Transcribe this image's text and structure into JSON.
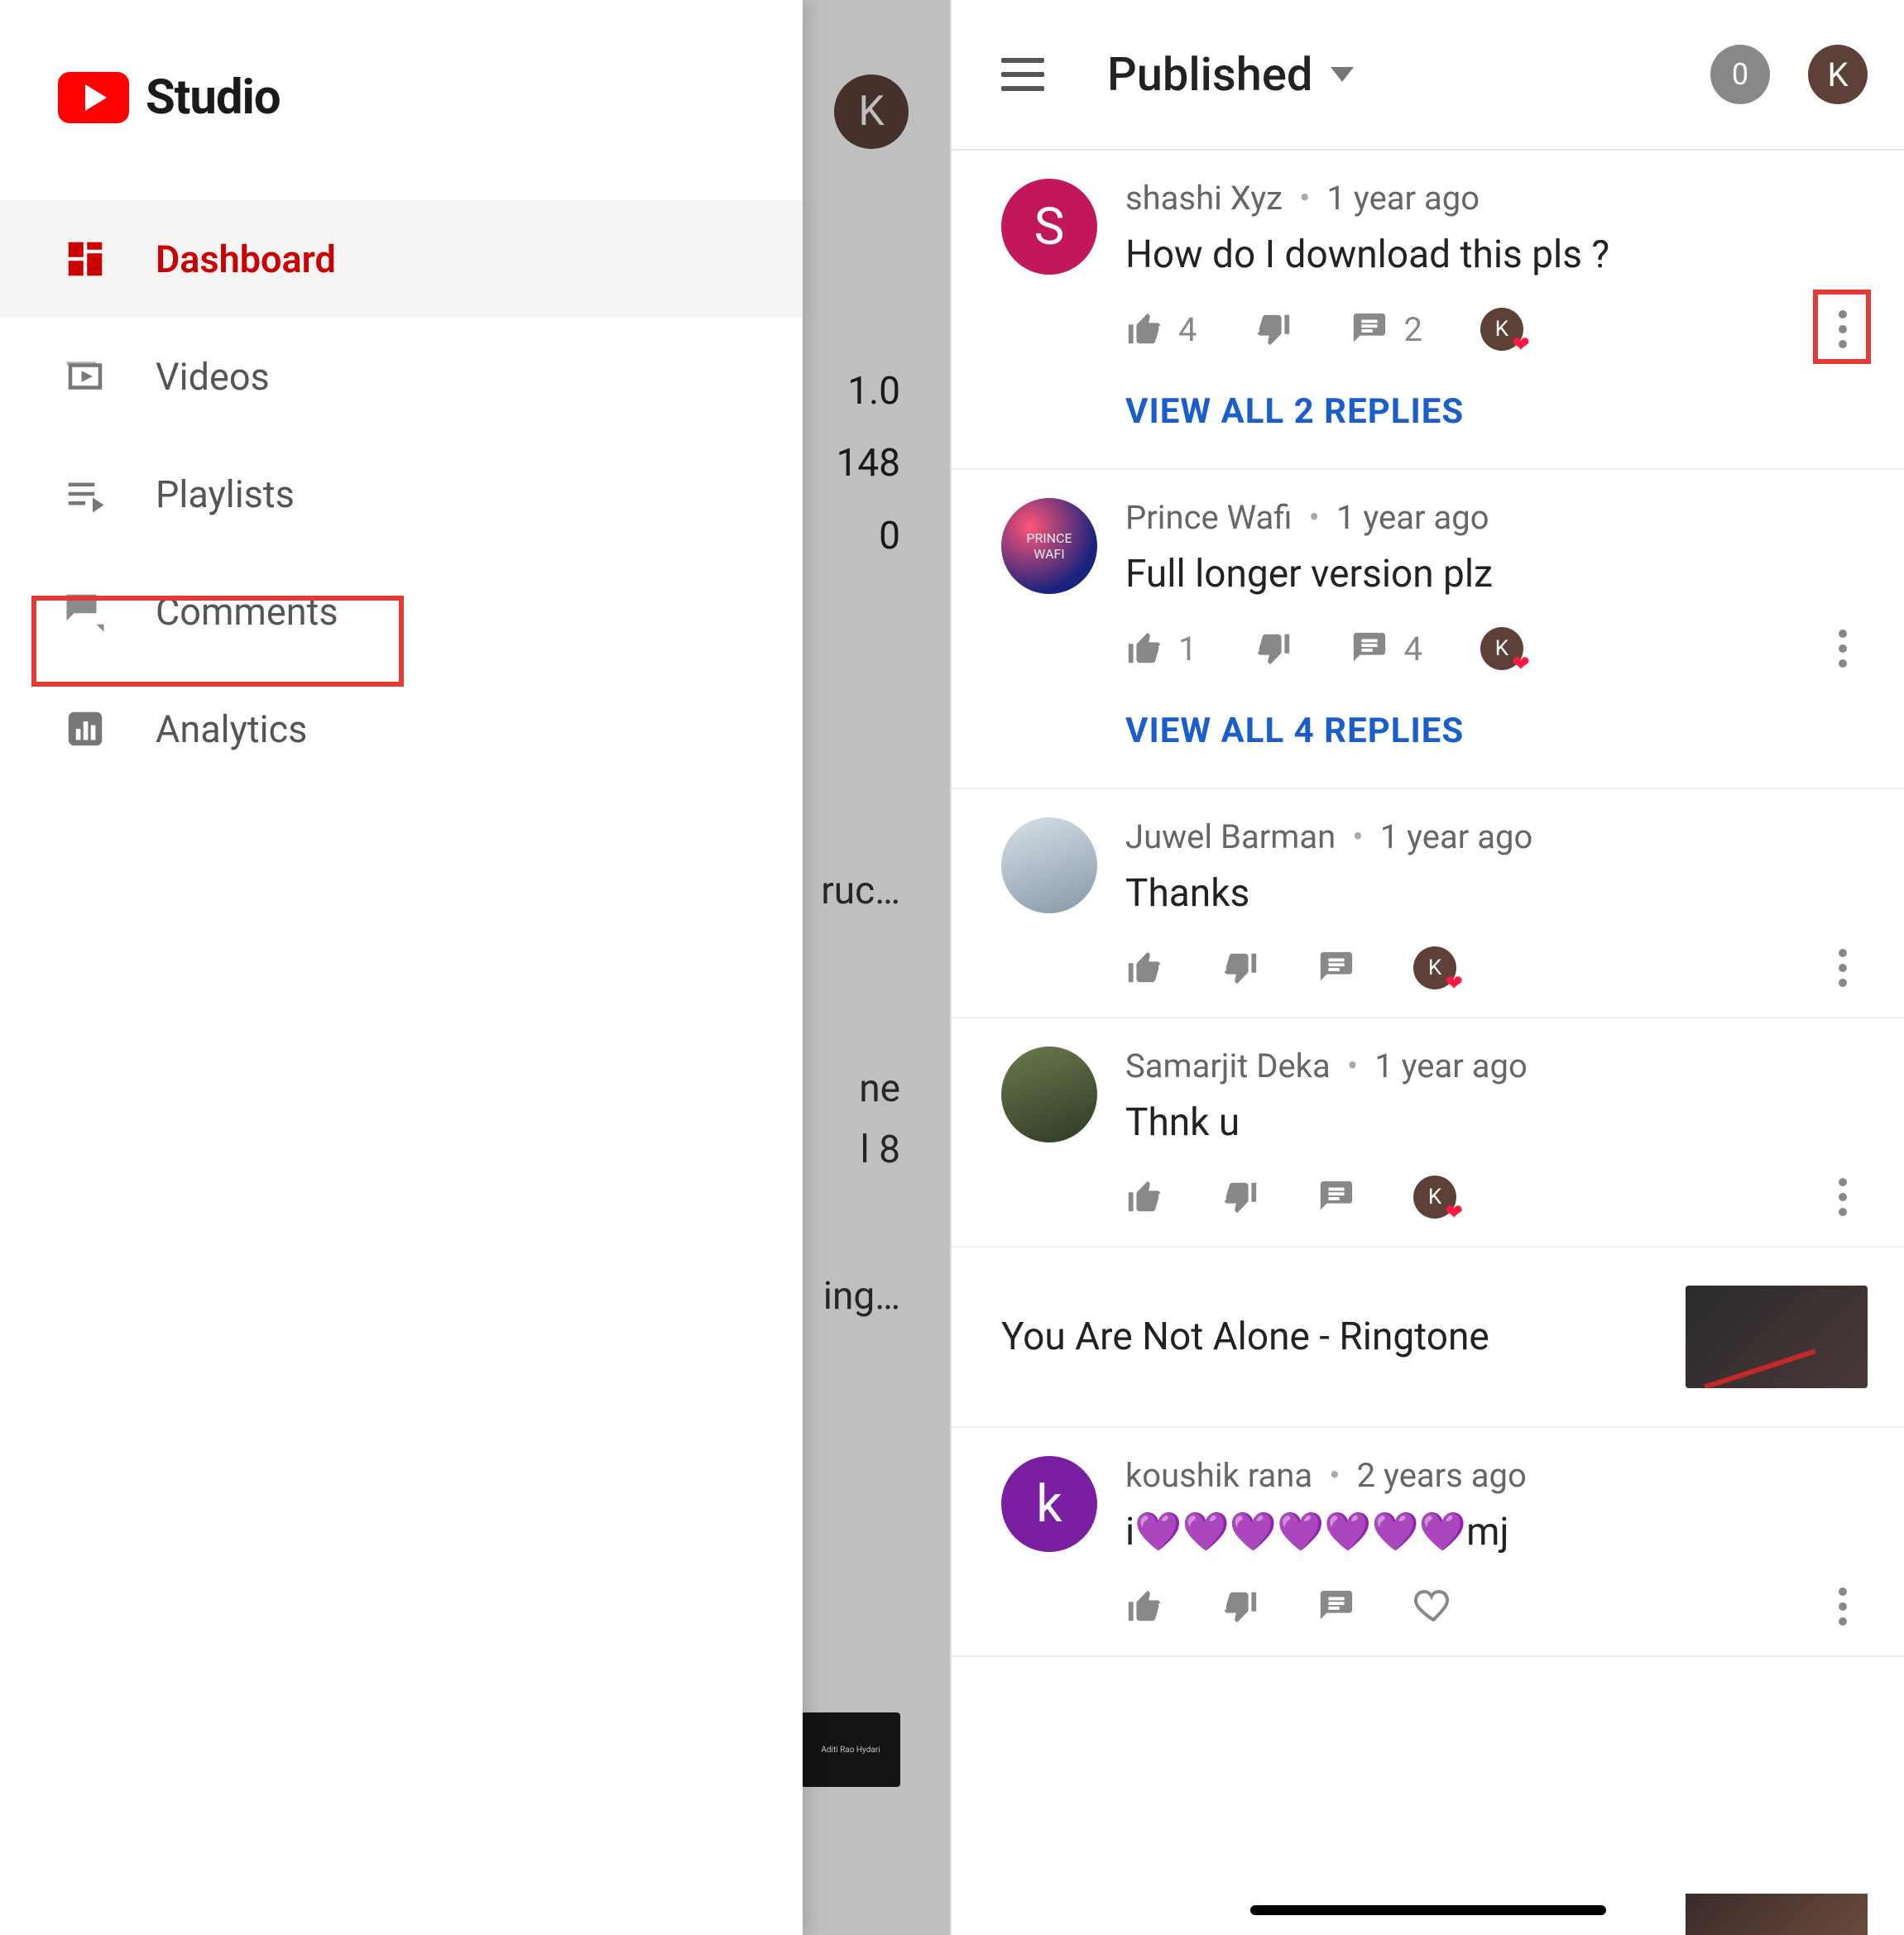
{
  "brand": "Studio",
  "sidebar": {
    "items": [
      {
        "label": "Dashboard",
        "icon": "dashboard-icon",
        "active": true
      },
      {
        "label": "Videos",
        "icon": "videos-icon"
      },
      {
        "label": "Playlists",
        "icon": "playlists-icon"
      },
      {
        "label": "Comments",
        "icon": "comments-icon",
        "highlighted": true
      },
      {
        "label": "Analytics",
        "icon": "analytics-icon"
      }
    ]
  },
  "left_bg": {
    "avatar_initial": "K",
    "stats": [
      "1.0",
      "148",
      "0"
    ],
    "frag1": "ruc…",
    "frag2_line1": "ne",
    "frag2_line2": "l 8",
    "frag3": "ing…",
    "thumb_text": "Aditi Rao Hydari"
  },
  "right_header": {
    "title": "Published",
    "badge": "0",
    "avatar_initial": "K"
  },
  "comments": [
    {
      "author": "shashi Xyz",
      "time": "1 year ago",
      "text": "How do I download this pls ?",
      "likes": "4",
      "replies_count": "2",
      "view_replies": "VIEW ALL 2 REPLIES",
      "avatar_initial": "S",
      "avatar_class": "av-pink",
      "hearted": true,
      "more_highlighted": true
    },
    {
      "author": "Prince Wafi",
      "time": "1 year ago",
      "text": "Full longer version plz",
      "likes": "1",
      "replies_count": "4",
      "view_replies": "VIEW ALL 4 REPLIES",
      "avatar_class": "av-img1",
      "hearted": true
    },
    {
      "author": "Juwel Barman",
      "time": "1 year ago",
      "text": "Thanks",
      "avatar_class": "av-img2",
      "hearted": true
    },
    {
      "author": "Samarjit Deka",
      "time": "1 year ago",
      "text": "Thnk u",
      "avatar_class": "av-img3",
      "hearted": true
    }
  ],
  "video_section": {
    "title": "You Are Not Alone - Ringtone"
  },
  "comments2": [
    {
      "author": "koushik rana",
      "time": "2 years ago",
      "text": "i💜💜💜💜💜💜💜mj",
      "avatar_initial": "k",
      "avatar_class": "av-purple",
      "hearted": false
    }
  ]
}
